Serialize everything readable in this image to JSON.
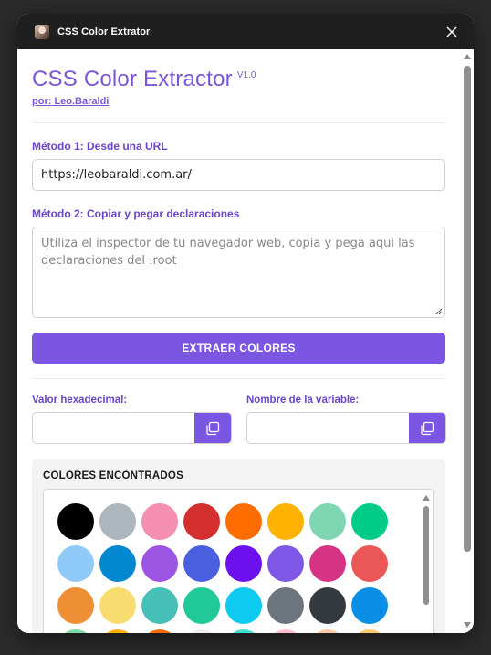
{
  "window": {
    "title": "CSS Color Extrator"
  },
  "header": {
    "title": "CSS Color Extractor",
    "version": "V1.0",
    "author": "por: Leo.Baraldi"
  },
  "method1": {
    "label": "Método 1: Desde una URL",
    "value": "https://leobaraldi.com.ar/"
  },
  "method2": {
    "label": "Método 2: Copiar y pegar declaraciones",
    "placeholder": "Utiliza el inspector de tu navegador web, copia y pega aqui las declaraciones del :root"
  },
  "extract_button": "EXTRAER COLORES",
  "hex": {
    "label": "Valor hexadecimal:",
    "value": ""
  },
  "variable": {
    "label": "Nombre de la variable:",
    "value": ""
  },
  "colors_section": {
    "title": "COLORES ENCONTRADOS"
  },
  "icons": {
    "close": "close-icon",
    "copy": "copy-icon",
    "app": "app-avatar-icon"
  },
  "accent_color": "#7b56e3",
  "swatches": [
    "#000000",
    "#adb5bd",
    "#f48fb1",
    "#d32f2f",
    "#ff6d00",
    "#ffb300",
    "#7ed6b2",
    "#00cc88",
    "#90caf9",
    "#0288d1",
    "#9c55e3",
    "#4a5ee0",
    "#6c10ee",
    "#7e57e6",
    "#d63384",
    "#eb5757",
    "#ef8f35",
    "#f7dc6f",
    "#47c1b7",
    "#20c997",
    "#0dcaf0",
    "#6c757d",
    "#343a40",
    "#0b8fe6",
    "#7fd8a6",
    "#ffb300",
    "#ff6d00",
    "#eeeeee",
    "#40e0d0",
    "#ffc0cb",
    "#ffccaa",
    "#ffc870"
  ]
}
